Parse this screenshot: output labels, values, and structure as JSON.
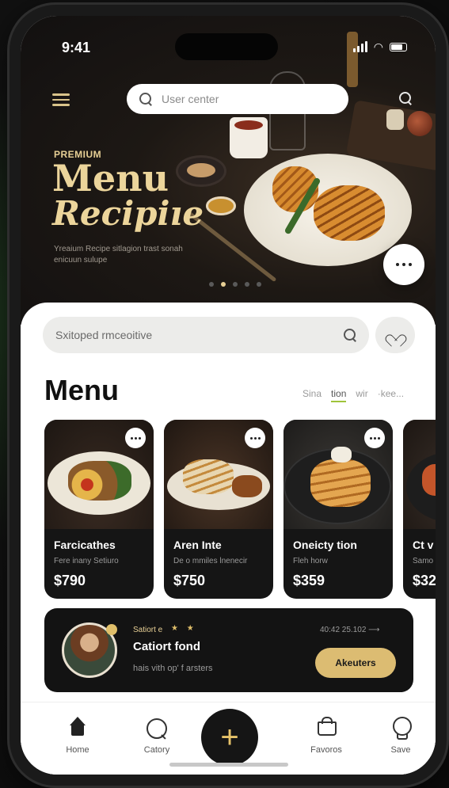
{
  "status": {
    "time": "9:41"
  },
  "header": {
    "search_placeholder": "User center"
  },
  "hero": {
    "eyebrow": "PREMIUM",
    "title_line1": "Menu",
    "title_line2": "Recipiıe",
    "description": "Yreaium Recipe sitlagion trast sonah enicuun sulupe",
    "carousel_active_index": 1,
    "carousel_count": 5
  },
  "sheet": {
    "search_text": "Sxitoped rmceoitive",
    "menu_title": "Menu",
    "filters": [
      "Sina",
      "tion",
      "wir",
      "·kee..."
    ],
    "active_filter": "tion"
  },
  "cards": [
    {
      "name": "Farcicathes",
      "sub": "Fere inany Setiuro",
      "price": "$790"
    },
    {
      "name": "Aren Inte",
      "sub": "De o mmiles lnenecir",
      "price": "$750"
    },
    {
      "name": "Oneicty tion",
      "sub": "Fleh horw",
      "price": "$359"
    },
    {
      "name": "Ct v",
      "sub": "Samo",
      "price": "$32"
    }
  ],
  "banner": {
    "small_label": "Satiort e",
    "stars": "★ ★",
    "title": "Catiort fond",
    "subtitle": "hais vith op' f arsters",
    "time": "40:42 25.102 ⟶",
    "cta": "Akeuters"
  },
  "tabbar": {
    "home": "Home",
    "category": "Catory",
    "add": "+",
    "favors": "Favoros",
    "save": "Save"
  },
  "colors": {
    "accent_gold": "#ecd59b",
    "dark": "#151515",
    "cta": "#dcbc72"
  }
}
